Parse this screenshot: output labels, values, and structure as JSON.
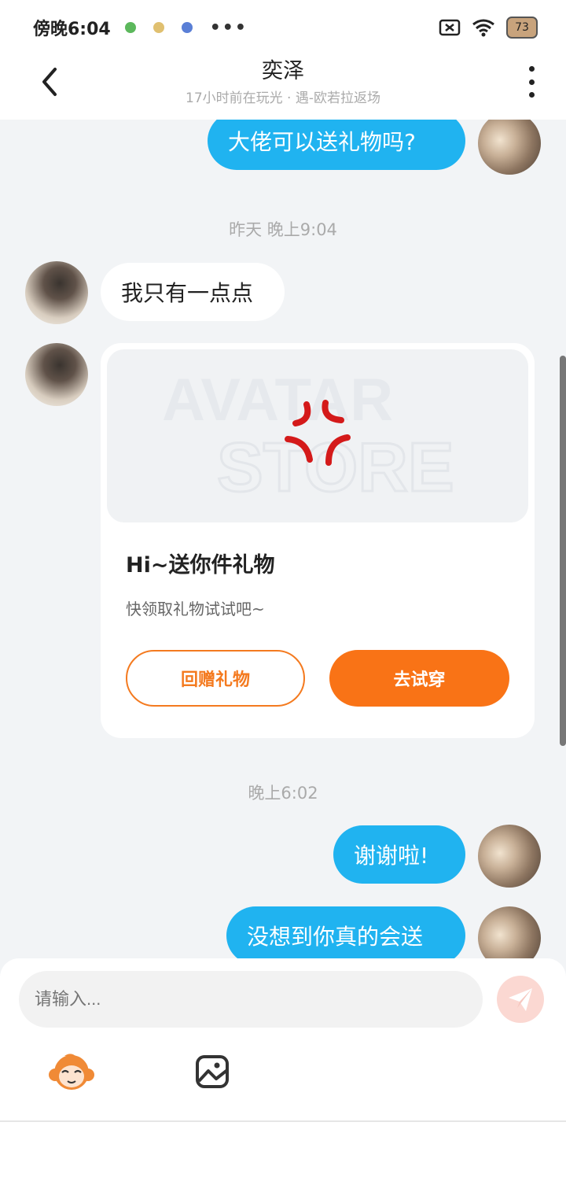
{
  "status_bar": {
    "time": "傍晚6:04",
    "more": "•••",
    "battery": "73"
  },
  "header": {
    "title": "奕泽",
    "subtitle": "17小时前在玩光 · 遇-欧若拉返场"
  },
  "messages": {
    "out_1": "大佬可以送礼物吗?",
    "time_1": "昨天 晚上9:04",
    "in_1": "我只有一点点",
    "gift_card": {
      "title": "Hi~送你件礼物",
      "description": "快领取礼物试试吧~",
      "return_label": "回赠礼物",
      "try_label": "去试穿"
    },
    "time_2": "晚上6:02",
    "out_2": "谢谢啦!",
    "out_3": "没想到你真的会送"
  },
  "input": {
    "placeholder": "请输入..."
  },
  "colors": {
    "accent_blue": "#20b3f0",
    "accent_orange": "#f97316",
    "background": "#f2f4f6"
  },
  "icons": {
    "back": "chevron-left-icon",
    "more": "more-vertical-icon",
    "send": "paper-plane-icon",
    "emoji": "monkey-mascot-icon",
    "image": "image-icon"
  }
}
